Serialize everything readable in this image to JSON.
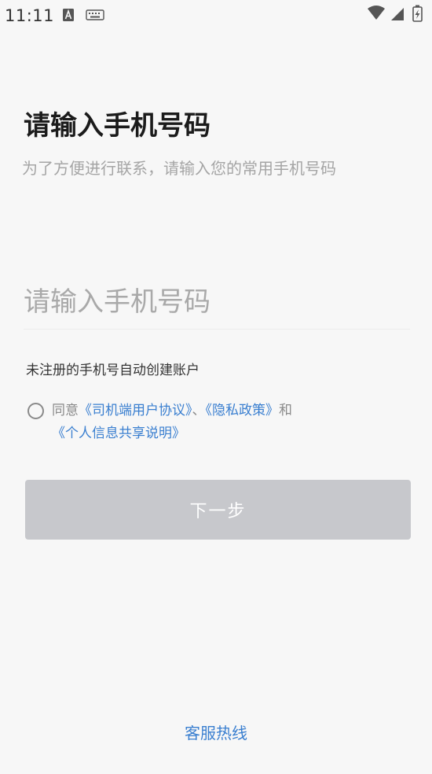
{
  "status_bar": {
    "time": "11:11",
    "left_icons": [
      "a-box-icon",
      "keyboard-icon"
    ],
    "right_icons": [
      "wifi-icon",
      "signal-icon",
      "battery-charging-icon"
    ]
  },
  "header": {
    "title": "请输入手机号码",
    "subtitle": "为了方便进行联系，请输入您的常用手机号码"
  },
  "form": {
    "phone_placeholder": "请输入手机号码",
    "phone_value": "",
    "hint": "未注册的手机号自动创建账户",
    "agreement": {
      "checked": false,
      "prefix": "同意",
      "driver_agreement": "《司机端用户协议》",
      "separator": "、",
      "privacy_policy": "《隐私政策》",
      "conjunction": "和",
      "info_sharing": "《个人信息共享说明》"
    },
    "next_label": "下一步"
  },
  "footer": {
    "hotline_label": "客服热线"
  },
  "colors": {
    "background": "#f7f7f7",
    "link": "#3a7fd0",
    "button_disabled": "#c7c8cc",
    "placeholder": "#a9a9a9"
  }
}
